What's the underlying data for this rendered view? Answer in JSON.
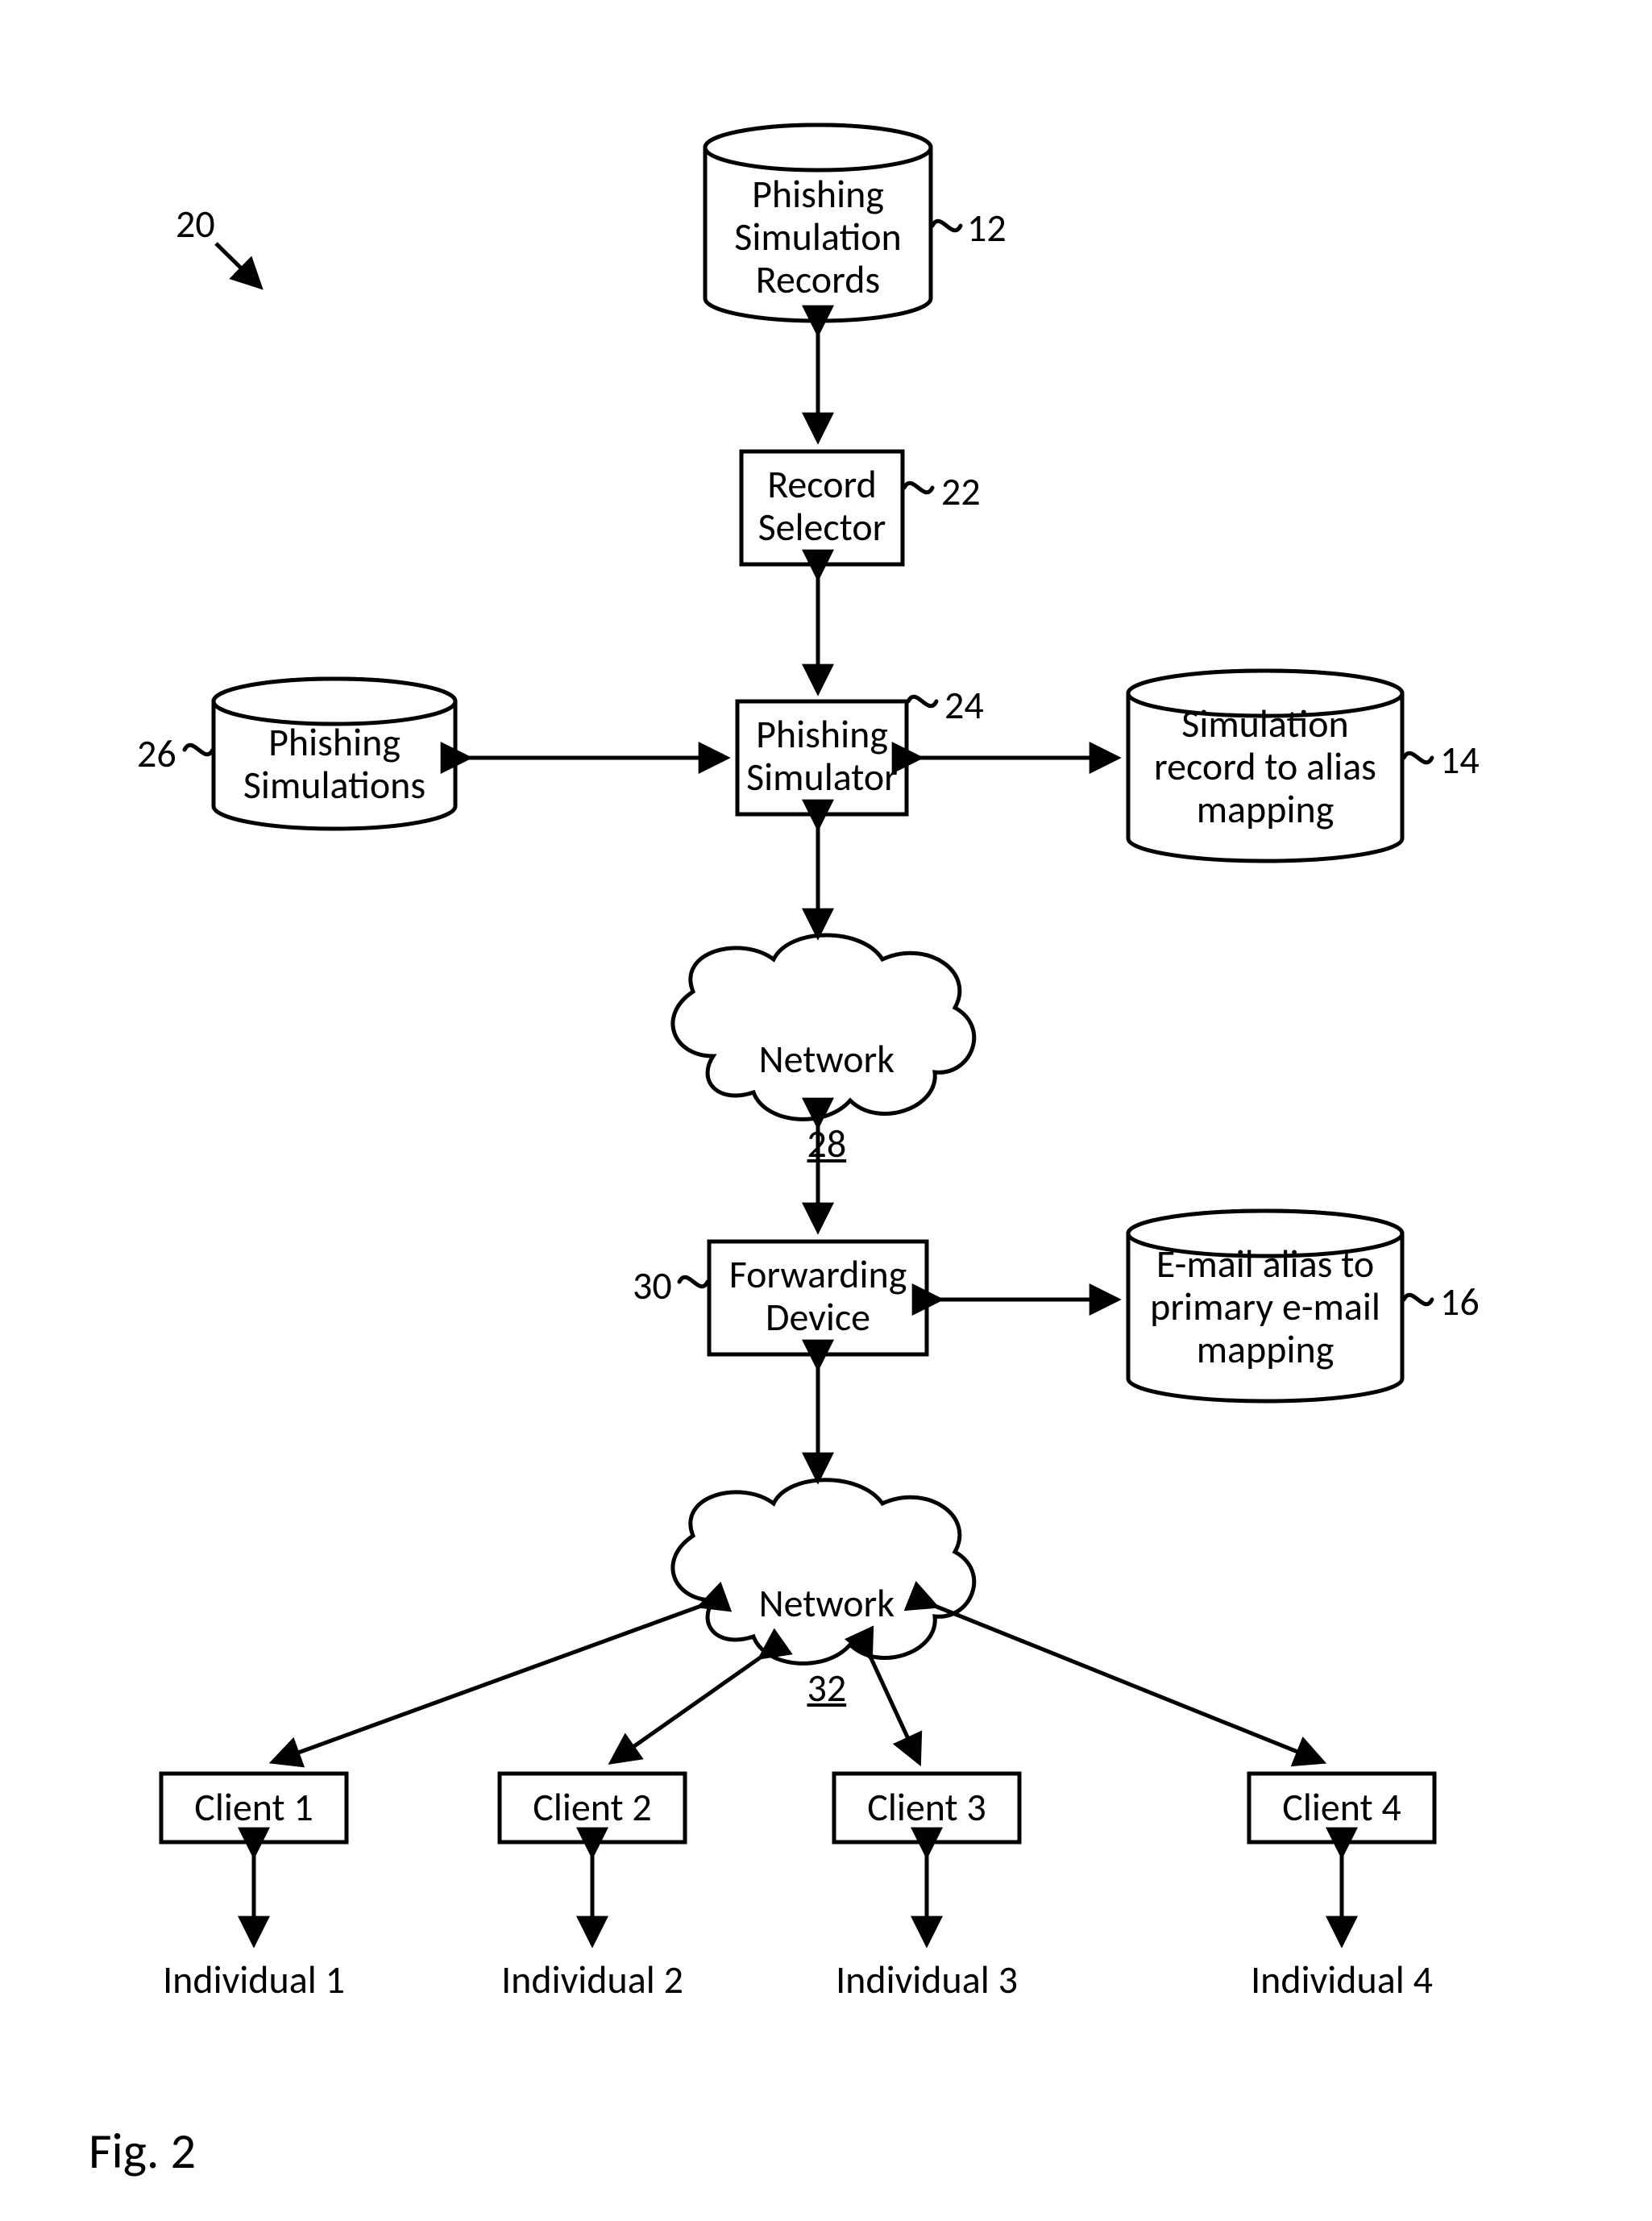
{
  "figure": {
    "label": "Fig. 2",
    "diagram_ref": "20"
  },
  "nodes": {
    "records": {
      "label": "Phishing\nSimulation\nRecords",
      "ref": "12"
    },
    "selector": {
      "label": "Record\nSelector",
      "ref": "22"
    },
    "simulator": {
      "label": "Phishing\nSimulator",
      "ref": "24"
    },
    "simulations": {
      "label": "Phishing\nSimulations",
      "ref": "26"
    },
    "alias_map": {
      "label": "Simulation\nrecord to alias\nmapping",
      "ref": "14"
    },
    "network1": {
      "label": "Network",
      "ref": "28"
    },
    "forwarding": {
      "label": "Forwarding\nDevice",
      "ref": "30"
    },
    "email_map": {
      "label": "E-mail alias to\nprimary e-mail\nmapping",
      "ref": "16"
    },
    "network2": {
      "label": "Network",
      "ref": "32"
    }
  },
  "clients": [
    {
      "box": "Client 1",
      "person": "Individual 1"
    },
    {
      "box": "Client 2",
      "person": "Individual 2"
    },
    {
      "box": "Client 3",
      "person": "Individual 3"
    },
    {
      "box": "Client 4",
      "person": "Individual 4"
    }
  ]
}
